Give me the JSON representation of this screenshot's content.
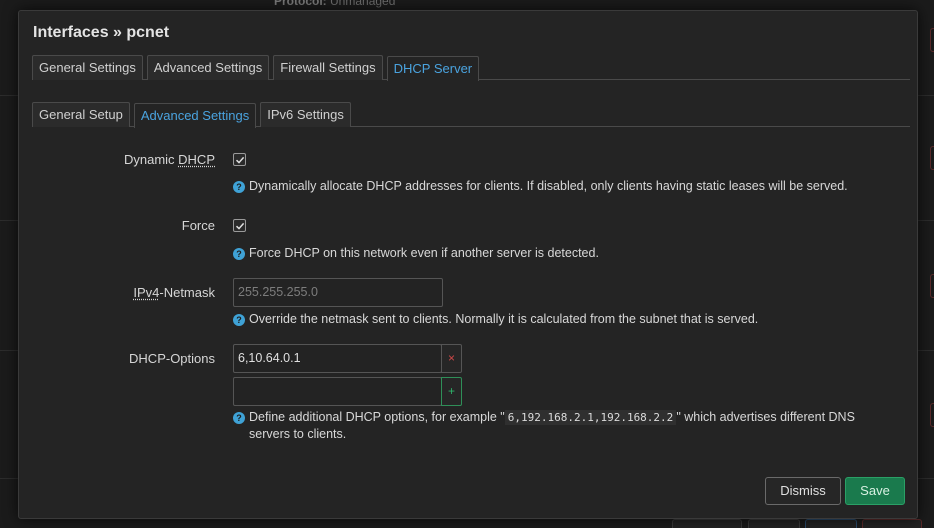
{
  "background": {
    "protocol_label": "Protocol:",
    "protocol_value": "Unmanaged"
  },
  "modal": {
    "title": "Interfaces » pcnet",
    "tabs": [
      {
        "label": "General Settings",
        "active": false
      },
      {
        "label": "Advanced Settings",
        "active": false
      },
      {
        "label": "Firewall Settings",
        "active": false
      },
      {
        "label": "DHCP Server",
        "active": true
      }
    ],
    "subtabs": [
      {
        "label": "General Setup",
        "active": false
      },
      {
        "label": "Advanced Settings",
        "active": true
      },
      {
        "label": "IPv6 Settings",
        "active": false
      }
    ],
    "fields": {
      "dynamic_dhcp": {
        "label_prefix": "Dynamic ",
        "label_abbr": "DHCP",
        "checked": true,
        "help": "Dynamically allocate DHCP addresses for clients. If disabled, only clients having static leases will be served."
      },
      "force": {
        "label": "Force",
        "checked": true,
        "help": "Force DHCP on this network even if another server is detected."
      },
      "ipv4_netmask": {
        "label_abbr": "IPv4",
        "label_suffix": "-Netmask",
        "placeholder": "255.255.255.0",
        "value": "",
        "help": "Override the netmask sent to clients. Normally it is calculated from the subnet that is served."
      },
      "dhcp_options": {
        "label": "DHCP-Options",
        "values": [
          "6,10.64.0.1",
          ""
        ],
        "remove_symbol": "×",
        "add_symbol": "+",
        "help_prefix": "Define additional DHCP options, for example \"",
        "help_code": "6,192.168.2.1,192.168.2.2",
        "help_suffix": "\" which advertises different DNS",
        "help_line2": "servers to clients."
      }
    },
    "buttons": {
      "dismiss": "Dismiss",
      "save": "Save"
    },
    "help_icon_glyph": "?",
    "colors": {
      "accent": "#4aa3df",
      "save": "#1a7a4d",
      "remove": "#d04848",
      "add": "#2fb36b"
    }
  }
}
